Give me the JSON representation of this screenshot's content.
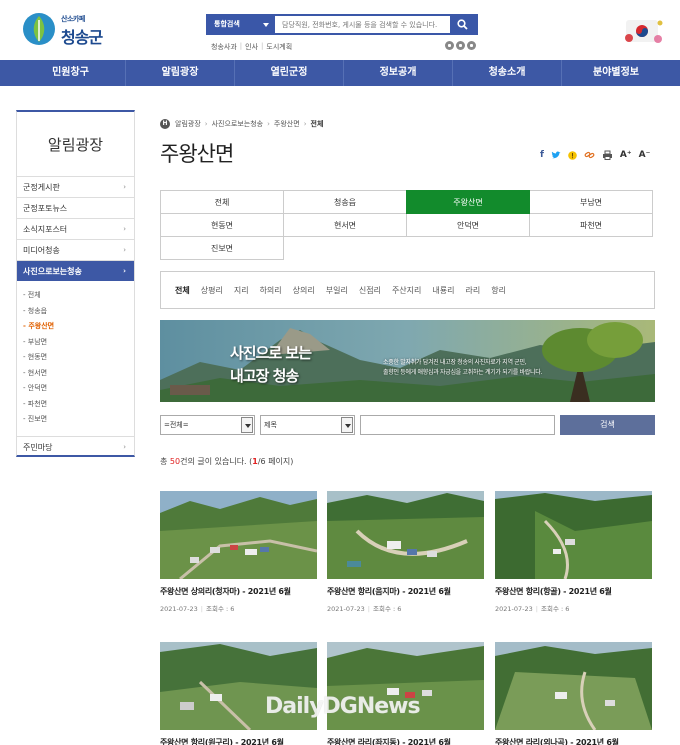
{
  "header": {
    "logo_slogan": "산소카페",
    "logo_name": "청송군",
    "search_scope": "통합검색",
    "search_placeholder": "담당직원, 전화번호, 게시물 등을 검색할 수 있습니다.",
    "quick_links": [
      "청송사과",
      "인사",
      "도시계획"
    ]
  },
  "gnb": [
    "민원창구",
    "알림광장",
    "열린군정",
    "정보공개",
    "청송소개",
    "분야별정보"
  ],
  "lnb": {
    "title": "알림광장",
    "items_top": [
      {
        "label": "군정게시판",
        "arrow": "›"
      },
      {
        "label": "군정포토뉴스",
        "arrow": ""
      },
      {
        "label": "소식지포스터",
        "arrow": "›"
      },
      {
        "label": "미디어청송",
        "arrow": "›"
      },
      {
        "label": "사진으로보는청송",
        "arrow": "›"
      }
    ],
    "sub_items": [
      "- 전체",
      "- 청송읍",
      "- 주왕산면",
      "- 부남면",
      "- 현동면",
      "- 현서면",
      "- 안덕면",
      "- 파천면",
      "- 진보면"
    ],
    "item_last": {
      "label": "주민마당",
      "arrow": "›"
    }
  },
  "breadcrumb": {
    "home": "H",
    "items": [
      "알림광장",
      "사진으로보는청송",
      "주왕산면",
      "전체"
    ]
  },
  "page_title": "주왕산면",
  "share_tools": {
    "font_up": "A⁺",
    "font_down": "A⁻"
  },
  "region_tabs": [
    [
      "전체",
      "청송읍",
      "주왕산면",
      "부남면"
    ],
    [
      "현동면",
      "현서면",
      "안덕면",
      "파천면"
    ],
    [
      "진보면"
    ]
  ],
  "village_tabs": [
    "전체",
    "상평리",
    "지리",
    "하의리",
    "상의리",
    "부일리",
    "신점리",
    "주산지리",
    "내룡리",
    "라리",
    "항리"
  ],
  "banner": {
    "title_line1": "사진으로 보는",
    "title_line2": "내고장 청송",
    "desc_line1": "소중한 발자취가 담겨진 내고장 청송의 사진자료가 지역 군민,",
    "desc_line2": "출향인 등에게 애향심과 자긍심을 고취하는 계기가 되기를 바랍니다."
  },
  "board_search": {
    "scope": "=전체=",
    "field": "제목",
    "keyword": "",
    "button": "검색"
  },
  "total": {
    "prefix": "총 ",
    "count": "50",
    "middle": "건의 글이 있습니다. (",
    "page": "1",
    "suffix": "/6 페이지)"
  },
  "gallery": [
    {
      "title": "주왕산면 상의리(청자마) - 2021년 6월",
      "date": "2021-07-23",
      "views": "조회수 : 6"
    },
    {
      "title": "주왕산면 항리(음지마) - 2021년 6월",
      "date": "2021-07-23",
      "views": "조회수 : 6"
    },
    {
      "title": "주왕산면 항리(항골) - 2021년 6월",
      "date": "2021-07-23",
      "views": "조회수 : 6"
    },
    {
      "title": "주왕산면 항리(원구리) - 2021년 6월",
      "date": "",
      "views": ""
    },
    {
      "title": "주왕산면 라리(좌지동) - 2021년 6월",
      "date": "",
      "views": ""
    },
    {
      "title": "주왕산면 라리(외나곡) - 2021년 6월",
      "date": "",
      "views": ""
    }
  ],
  "watermark": "DailyDGNews",
  "colors": {
    "primary": "#3d58a5",
    "active_tab": "#128b2c",
    "accent_orange": "#e06000",
    "count_red": "#e02020"
  }
}
